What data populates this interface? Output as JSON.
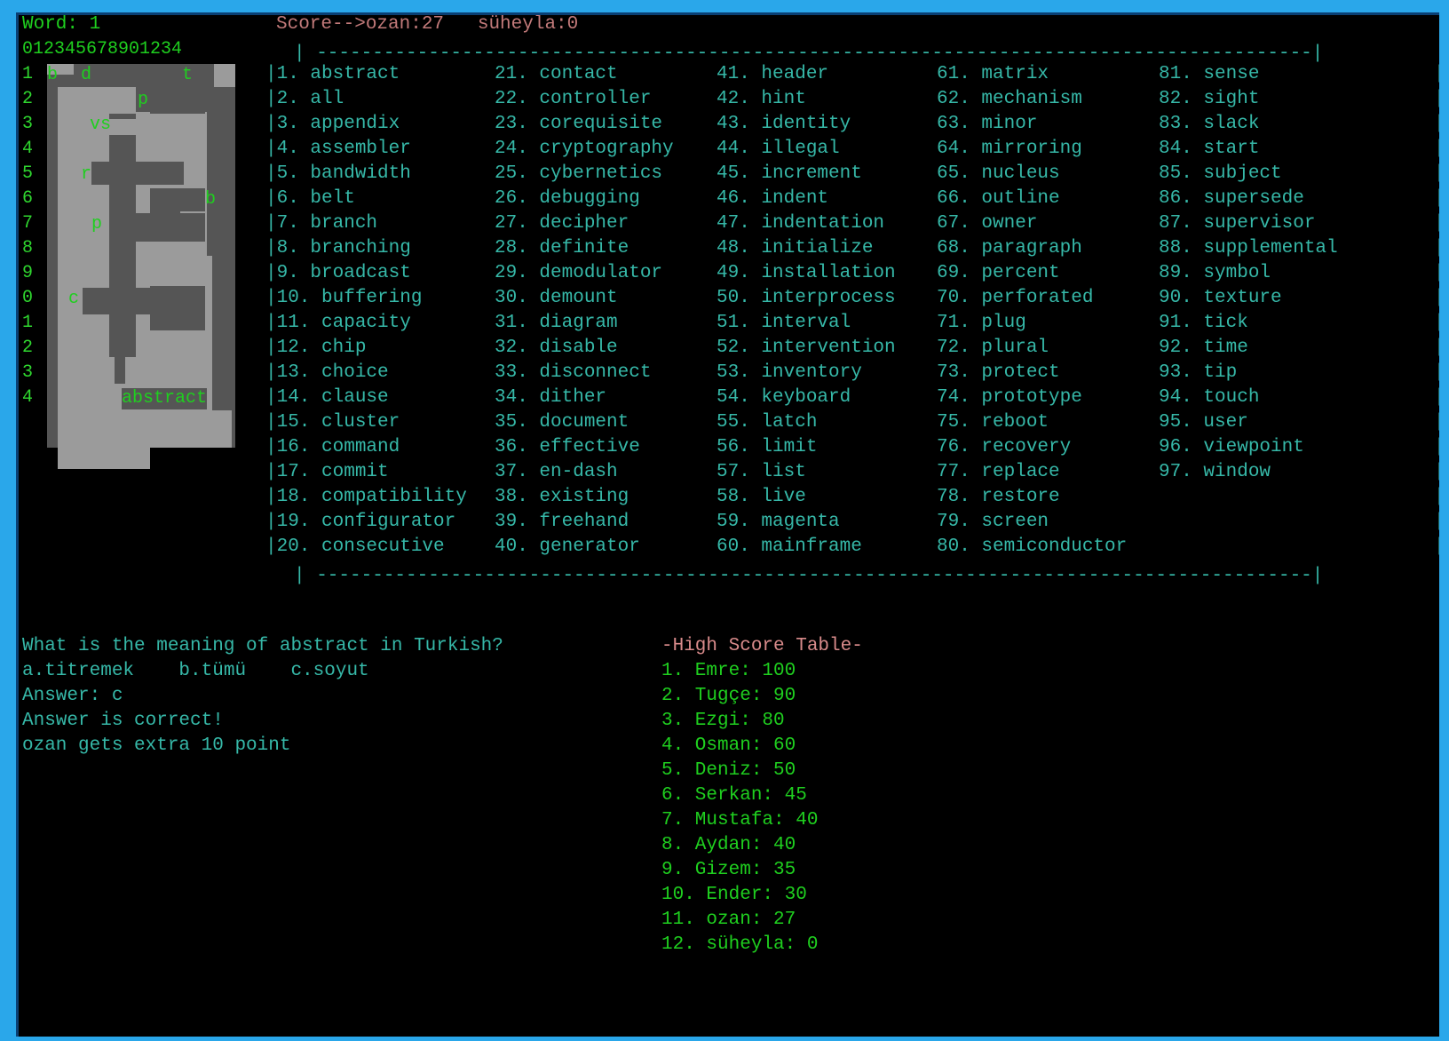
{
  "status": {
    "word_label": "Word: 1",
    "score_label": "Score-->ozan:27   süheyla:0"
  },
  "grid": {
    "col_header": "012345678901234",
    "row_labels": [
      "1",
      "2",
      "3",
      "4",
      "5",
      "6",
      "7",
      "8",
      "9",
      "0",
      "1",
      "2",
      "3",
      "4"
    ],
    "letters": [
      "b",
      "d",
      "t",
      "p",
      "vs",
      "r",
      "b",
      "p",
      "c",
      "abstract"
    ]
  },
  "word_list": {
    "separator": "| -----------------------------------------------------------------------------------------|",
    "columns": [
      [
        "|1. abstract",
        "|2. all",
        "|3. appendix",
        "|4. assembler",
        "|5. bandwidth",
        "|6. belt",
        "|7. branch",
        "|8. branching",
        "|9. broadcast",
        "|10. buffering",
        "|11. capacity",
        "|12. chip",
        "|13. choice",
        "|14. clause",
        "|15. cluster",
        "|16. command",
        "|17. commit",
        "|18. compatibility",
        "|19. configurator",
        "|20. consecutive"
      ],
      [
        "21. contact",
        "22. controller",
        "23. corequisite",
        "24. cryptography",
        "25. cybernetics",
        "26. debugging",
        "27. decipher",
        "28. definite",
        "29. demodulator",
        "30. demount",
        "31. diagram",
        "32. disable",
        "33. disconnect",
        "34. dither",
        "35. document",
        "36. effective",
        "37. en-dash",
        "38. existing",
        "39. freehand",
        "40. generator"
      ],
      [
        "41. header",
        "42. hint",
        "43. identity",
        "44. illegal",
        "45. increment",
        "46. indent",
        "47. indentation",
        "48. initialize",
        "49. installation",
        "50. interprocess",
        "51. interval",
        "52. intervention",
        "53. inventory",
        "54. keyboard",
        "55. latch",
        "56. limit",
        "57. list",
        "58. live",
        "59. magenta",
        "60. mainframe"
      ],
      [
        "61. matrix",
        "62. mechanism",
        "63. minor",
        "64. mirroring",
        "65. nucleus",
        "66. outline",
        "67. owner",
        "68. paragraph",
        "69. percent",
        "70. perforated",
        "71. plug",
        "72. plural",
        "73. protect",
        "74. prototype",
        "75. reboot",
        "76. recovery",
        "77. replace",
        "78. restore",
        "79. screen",
        "80. semiconductor"
      ],
      [
        "81. sense",
        "82. sight",
        "83. slack",
        "84. start",
        "85. subject",
        "86. supersede",
        "87. supervisor",
        "88. supplemental",
        "89. symbol",
        "90. texture",
        "91. tick",
        "92. time",
        "93. tip",
        "94. touch",
        "95. user",
        "96. viewpoint",
        "97. window"
      ]
    ],
    "right_bar": "|"
  },
  "quiz": {
    "question": "What is the meaning of abstract in Turkish?",
    "options": "a.titremek    b.tümü    c.soyut",
    "answer": "Answer: c",
    "result": "Answer is correct!",
    "bonus": "ozan gets extra 10 point"
  },
  "high_scores": {
    "title": "-High Score Table-",
    "entries": [
      "1. Emre: 100",
      "2. Tugçe: 90",
      "3. Ezgi: 80",
      "4. Osman: 60",
      "5. Deniz: 50",
      "6. Serkan: 45",
      "7. Mustafa: 40",
      "8. Aydan: 40",
      "9. Gizem: 35",
      "10. Ender: 30",
      "11. ozan: 27",
      "12. süheyla: 0"
    ]
  }
}
